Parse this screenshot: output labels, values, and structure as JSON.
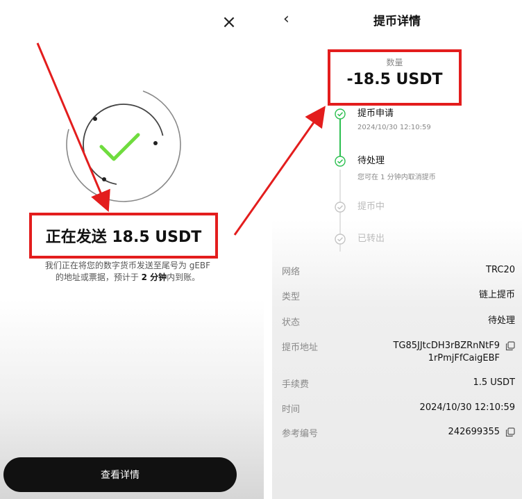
{
  "left": {
    "close_icon": "×",
    "send_title": "正在发送 18.5 USDT",
    "desc_part1": "我们正在将您的数字货币发送至尾号为 gEBF",
    "desc_part2": "的地址或票据，预计于 ",
    "desc_bold": "2 分钟",
    "desc_part3": "内到账。",
    "view_button": "查看详情"
  },
  "right": {
    "back_icon": "‹",
    "title": "提币详情",
    "amount_label": "数量",
    "amount_value": "-18.5 USDT",
    "steps": [
      {
        "label": "提币申请",
        "sub": "2024/10/30 12:10:59",
        "state": "done"
      },
      {
        "label": "待处理",
        "sub": "您可在 1 分钟内取消提币",
        "state": "active"
      },
      {
        "label": "提币中",
        "sub": "",
        "state": "pending"
      },
      {
        "label": "已转出",
        "sub": "",
        "state": "pending"
      }
    ],
    "details": {
      "network_label": "网络",
      "network_value": "TRC20",
      "type_label": "类型",
      "type_value": "链上提币",
      "status_label": "状态",
      "status_value": "待处理",
      "address_label": "提币地址",
      "address_line1": "TG85JJtcDH3rBZRnNtF9",
      "address_line2": "1rPmjFfCaigEBF",
      "fee_label": "手续费",
      "fee_value": "1.5 USDT",
      "time_label": "时间",
      "time_value": "2024/10/30 12:10:59",
      "ref_label": "参考编号",
      "ref_value": "242699355"
    }
  },
  "colors": {
    "highlight": "#e31d1d",
    "success": "#2bbf4f",
    "pending": "#c4c4c4",
    "primary_button": "#111111"
  }
}
